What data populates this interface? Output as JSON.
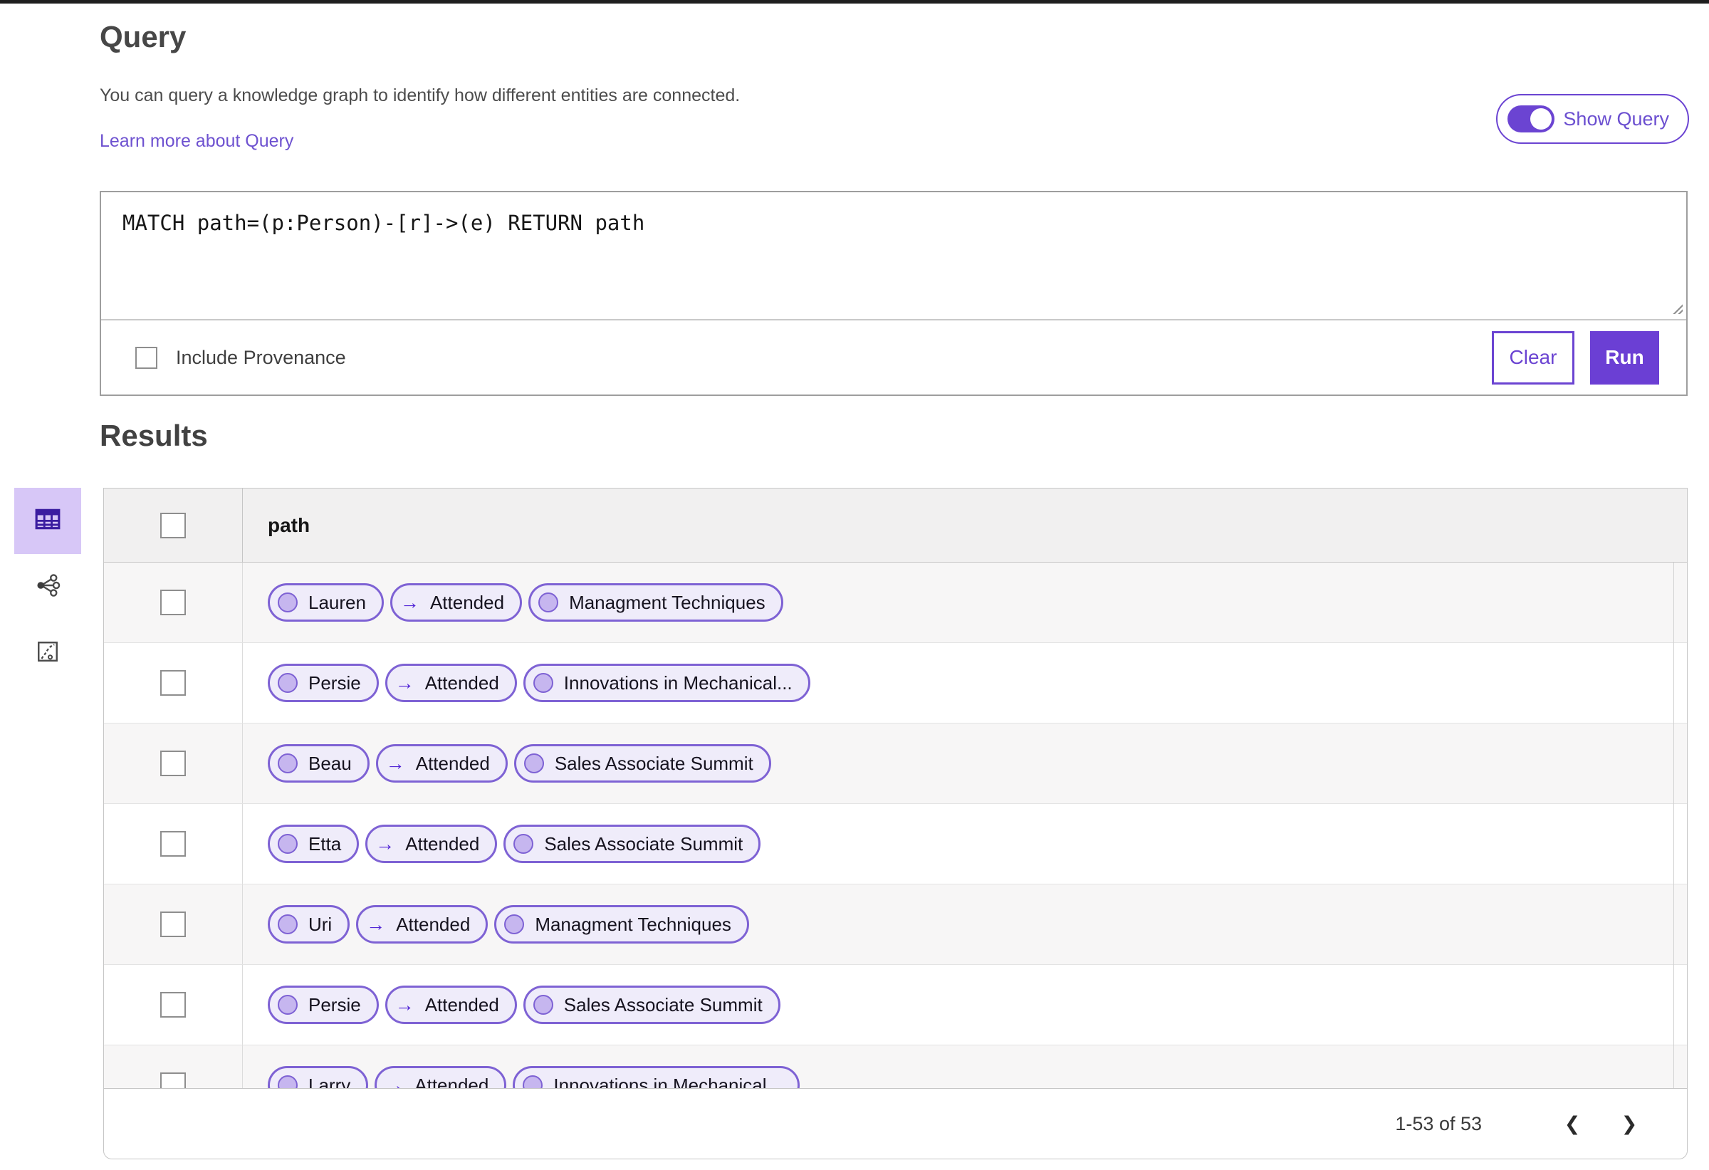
{
  "colors": {
    "accent_purple": "#6b3fd4",
    "link_purple": "#6e52d0",
    "pill_border": "#7e62d4",
    "pill_background": "#efecfa",
    "node_circle_fill": "#c6b6ef",
    "active_view_background": "#d7c7f7",
    "active_view_icon": "#3b1da0",
    "table_header_background": "#f1f0f0",
    "zebra_row_background": "#f7f6f6"
  },
  "query_section": {
    "title": "Query",
    "description": "You can query a knowledge graph to identify how different entities are connected.",
    "learn_more_link": "Learn more about Query",
    "show_query_label": "Show Query",
    "show_query_toggle_state": "on",
    "query_text": "MATCH path=(p:Person)-[r]->(e) RETURN path",
    "include_provenance_label": "Include Provenance",
    "include_provenance_checked": false,
    "clear_button_label": "Clear",
    "run_button_label": "Run"
  },
  "results_section": {
    "title": "Results",
    "view_switcher": {
      "items": [
        {
          "icon": "table-view-icon",
          "active": true
        },
        {
          "icon": "graph-view-icon",
          "active": false
        },
        {
          "icon": "chart-view-icon",
          "active": false
        }
      ]
    },
    "table": {
      "column_header": "path",
      "pill_arrow": "→",
      "rows": [
        {
          "source": "Lauren",
          "edge": "Attended",
          "target": "Managment Techniques"
        },
        {
          "source": "Persie",
          "edge": "Attended",
          "target": "Innovations in Mechanical..."
        },
        {
          "source": "Beau",
          "edge": "Attended",
          "target": "Sales Associate Summit"
        },
        {
          "source": "Etta",
          "edge": "Attended",
          "target": "Sales Associate Summit"
        },
        {
          "source": "Uri",
          "edge": "Attended",
          "target": "Managment Techniques"
        },
        {
          "source": "Persie",
          "edge": "Attended",
          "target": "Sales Associate Summit"
        },
        {
          "source": "Larry",
          "edge": "Attended",
          "target": "Innovations in Mechanical..."
        }
      ]
    },
    "pagination": {
      "range_text": "1-53 of 53",
      "prev_icon": "❮",
      "next_icon": "❯"
    }
  }
}
